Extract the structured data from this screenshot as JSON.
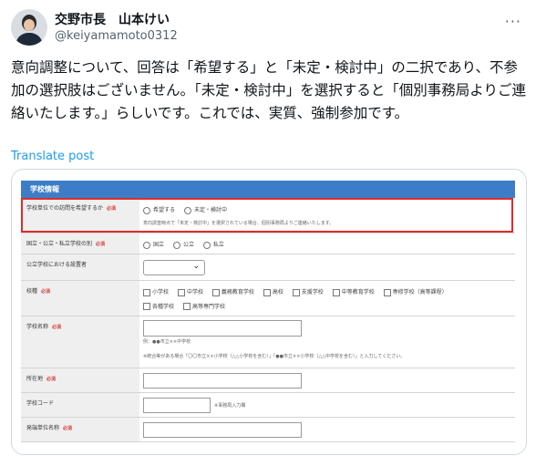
{
  "author": {
    "name": "交野市長　山本けい",
    "handle": "@keiyamamoto0312",
    "avatar_icon": "avatar-photo"
  },
  "more_icon": "more-options-icon",
  "tweet": {
    "text": "意向調整について、回答は「希望する」と「未定・検討中」の二択であり、不参加の選択肢はございません。「未定・検討中」を選択すると「個別事務局よりご連絡いたします。」らしいです。これでは、実質、強制参加です。",
    "translate_label": "Translate post"
  },
  "form": {
    "header": "学校情報",
    "required_mark": "必須",
    "visit": {
      "label": "学校単位での訪問を希望するか",
      "option1": "希望する",
      "option2": "未定・検討中",
      "note": "意向調査時点で「未定・検討中」を選択されている場合、個別事務局よりご連絡いたします。"
    },
    "kind": {
      "label": "国立・公立・私立学校の別",
      "option1": "国立",
      "option2": "公立",
      "option3": "私立"
    },
    "board": {
      "label": "公立学校における設置者"
    },
    "type": {
      "label": "校種",
      "options_row1": [
        "小学校",
        "中学校",
        "義務教育学校",
        "高校",
        "支援学校",
        "中等教育学校",
        "専修学校（高等課程）"
      ],
      "options_row2": [
        "各種学校",
        "高等専門学校"
      ]
    },
    "school_name": {
      "label": "学校名称",
      "example": "例：●●市立××中学校",
      "note": "※統合等がある場合「〇〇市立××小学校（△△小学校を含む）」「●●市立××小学校（△△中学校を含む）」と入力してください。"
    },
    "address": {
      "label": "所在地"
    },
    "code": {
      "label": "学校コード",
      "note": "※事務局入力欄"
    },
    "sender": {
      "label": "発端単位名称"
    }
  }
}
